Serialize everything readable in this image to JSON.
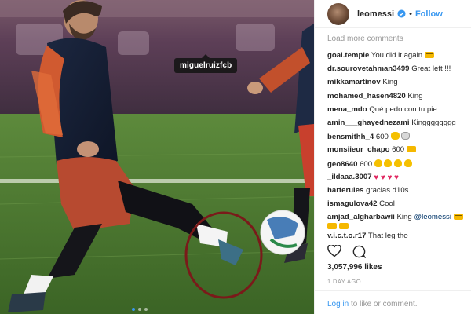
{
  "photo": {
    "tag_username": "miguelruizfcb",
    "highlight_color": "#7a1a1a"
  },
  "header": {
    "username": "leomessi",
    "separator": "•",
    "follow_label": "Follow",
    "verified_color": "#3897f0"
  },
  "comments": {
    "load_more": "Load more comments",
    "items": [
      {
        "user": "goal.temple",
        "text": "You did it again",
        "emoji": [
          "crown-icon"
        ]
      },
      {
        "user": "dr.sourovetahman3499",
        "text": "Great left !!!",
        "emoji": []
      },
      {
        "user": "mikkamartinov",
        "text": "King",
        "emoji": []
      },
      {
        "user": "mohamed_hasen4820",
        "text": "King",
        "emoji": []
      },
      {
        "user": "mena_mdo",
        "text": "Qué pedo con tu pie",
        "emoji": []
      },
      {
        "user": "amin___ghayednezami",
        "text": "Kingggggggg",
        "emoji": []
      },
      {
        "user": "bensmithh_4",
        "text": "600",
        "emoji": [
          "clap-icon",
          "goat-icon"
        ]
      },
      {
        "user": "monsiieur_chapo",
        "text": "600",
        "emoji": [
          "crown-icon"
        ]
      },
      {
        "user": "geo8640",
        "text": "600",
        "emoji": [
          "pray-icon",
          "pray-icon",
          "pray-icon",
          "pray-icon"
        ]
      },
      {
        "user": "_ildaaa.3007",
        "text": "",
        "emoji": [
          "heart-icon",
          "heart-icon",
          "heart-icon",
          "heart-icon"
        ]
      },
      {
        "user": "harterules",
        "text": "gracias d10s",
        "emoji": []
      },
      {
        "user": "ismagulova42",
        "text": "Cool",
        "emoji": []
      },
      {
        "user": "amjad_algharbawii",
        "text": "King",
        "mention": "@leomessi",
        "emoji": [
          "crown-icon",
          "crown-icon",
          "crown-icon"
        ]
      },
      {
        "user": "v.i.c.t.o.r17",
        "text": "That leg tho",
        "emoji": []
      }
    ]
  },
  "actions": {
    "like_icon": "heart-outline-icon",
    "comment_icon": "comment-bubble-icon"
  },
  "likes": "3,057,996 likes",
  "time_ago": "1 DAY AGO",
  "login": {
    "link": "Log in",
    "suffix": " to like or comment."
  }
}
